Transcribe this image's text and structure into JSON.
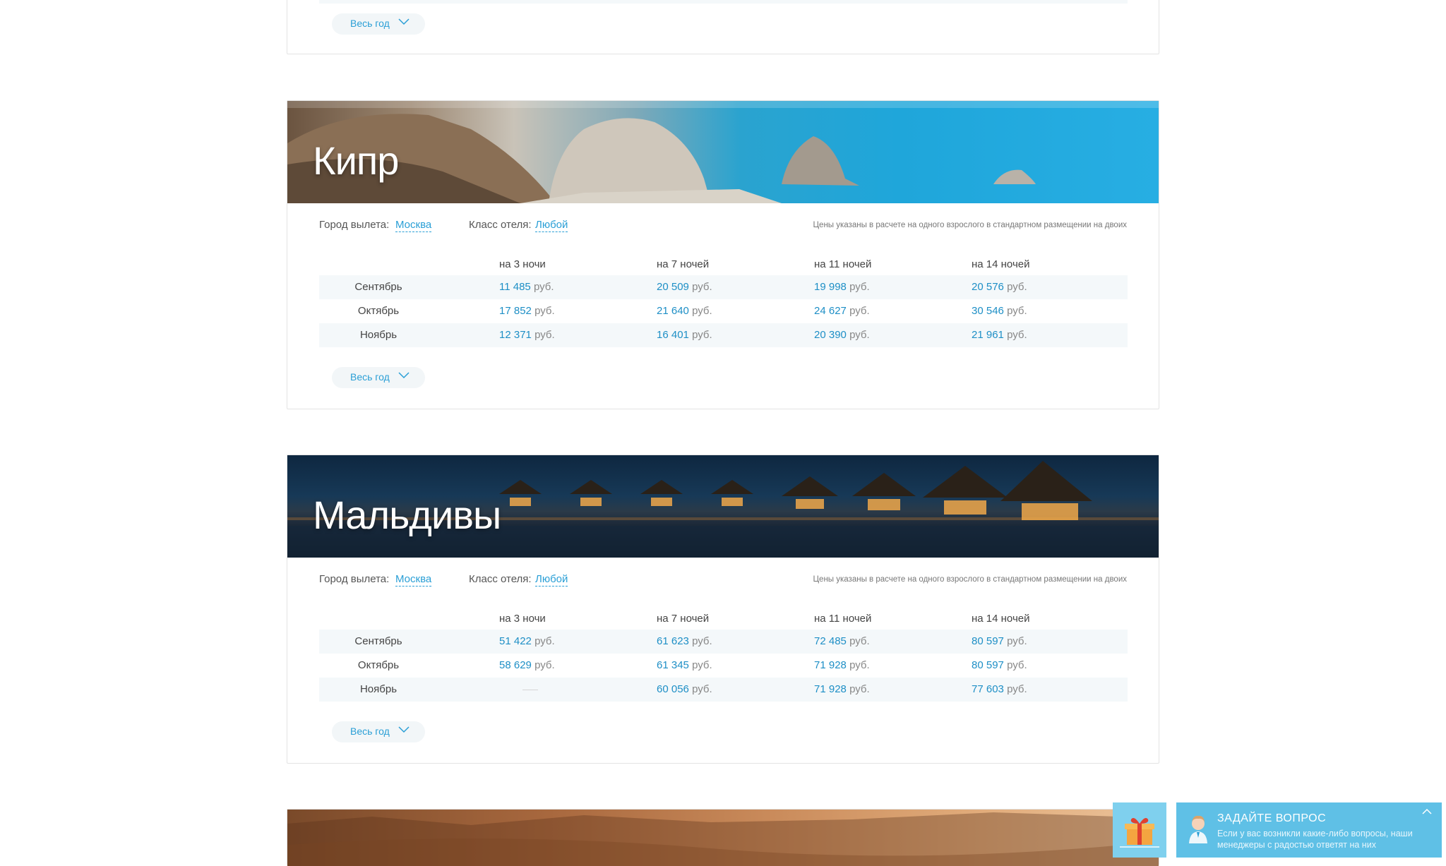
{
  "year_label": "Весь год",
  "currency": "руб.",
  "filters": {
    "city_label": "Город вылета:",
    "city_value": "Москва",
    "hotel_label": "Класс отеля:",
    "hotel_value": "Любой",
    "note": "Цены указаны в расчете на одного взрослого в стандартном размещении на двоих"
  },
  "columns": [
    "на 3 ночи",
    "на 7 ночей",
    "на 11 ночей",
    "на 14 ночей"
  ],
  "destinations": [
    {
      "title": "Кипр",
      "rows": [
        {
          "month": "Сентябрь",
          "prices": [
            "11 485",
            "20 509",
            "19 998",
            "20 576"
          ]
        },
        {
          "month": "Октябрь",
          "prices": [
            "17 852",
            "21 640",
            "24 627",
            "30 546"
          ]
        },
        {
          "month": "Ноябрь",
          "prices": [
            "12 371",
            "16 401",
            "20 390",
            "21 961"
          ]
        }
      ]
    },
    {
      "title": "Мальдивы",
      "rows": [
        {
          "month": "Сентябрь",
          "prices": [
            "51 422",
            "61 623",
            "72 485",
            "80 597"
          ]
        },
        {
          "month": "Октябрь",
          "prices": [
            "58 629",
            "61 345",
            "71 928",
            "80 597"
          ]
        },
        {
          "month": "Ноябрь",
          "prices": [
            "",
            "60 056",
            "71 928",
            "77 603"
          ]
        }
      ]
    }
  ],
  "widget": {
    "title": "ЗАДАЙТЕ ВОПРОС",
    "text": "Если у вас возникли какие-либо вопросы, наши менеджеры с радостью ответят на них"
  },
  "colors": {
    "accent": "#2a9fd6",
    "widget": "#5fc0e6"
  }
}
